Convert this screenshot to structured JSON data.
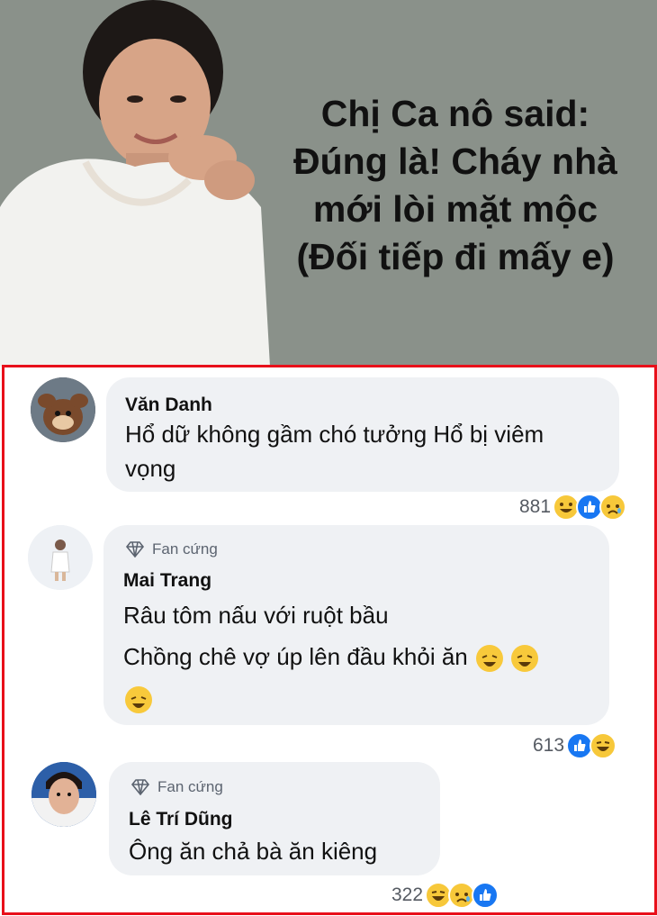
{
  "banner": {
    "headline": [
      "Chị Ca nô said:",
      "Đúng là! Cháy nhà",
      "mới lòi mặt mộc",
      "(Đối tiếp đi mấy e)"
    ]
  },
  "colors": {
    "frame": "#e8101a",
    "bubble": "#eff1f4",
    "like": "#1877f2",
    "banner_bg": "#8a918a"
  },
  "comments": [
    {
      "name": "Văn Danh",
      "badge": "",
      "lines": [
        "Hổ dữ không gầm chó tưởng Hổ bị viêm",
        "vọng"
      ],
      "react_count": "881",
      "reactions": [
        "haha-icon",
        "like-icon",
        "sad-icon"
      ]
    },
    {
      "name": "Mai Trang",
      "badge": "Fan cứng",
      "lines": [
        "Râu tôm nấu với ruột bầu",
        "Chồng chê vợ úp lên đầu khỏi ăn",
        ""
      ],
      "react_count": "613",
      "reactions": [
        "like-icon",
        "haha-icon"
      ]
    },
    {
      "name": "Lê Trí Dũng",
      "badge": "Fan cứng",
      "lines": [
        "Ông ăn chả bà ăn kiêng"
      ],
      "react_count": "322",
      "reactions": [
        "haha-icon",
        "sad-icon",
        "like-icon"
      ]
    }
  ]
}
